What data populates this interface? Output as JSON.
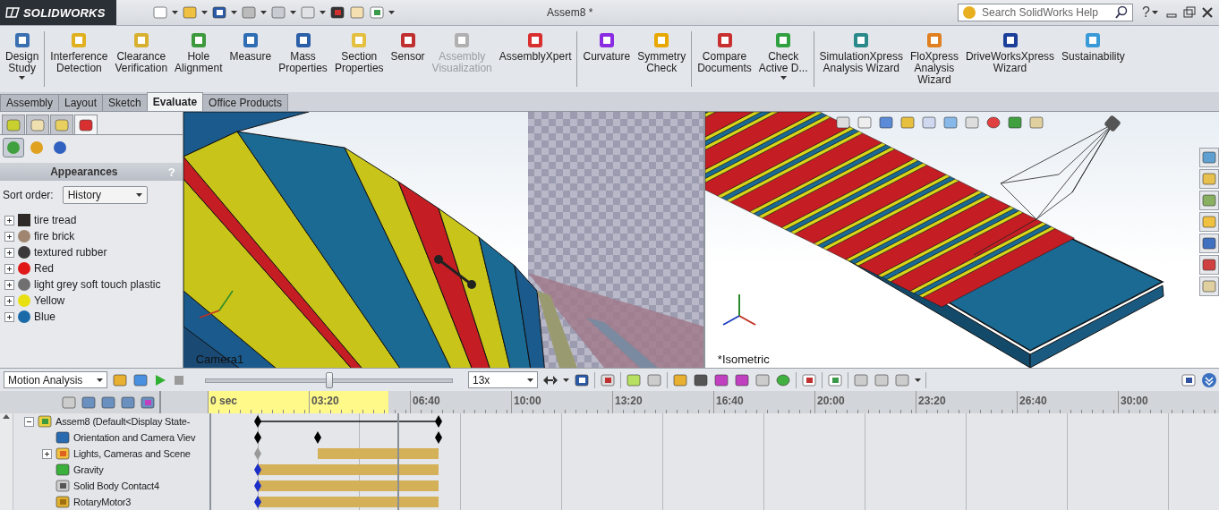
{
  "title_bar": {
    "logo": "SOLIDWORKS",
    "document_title": "Assem8 *",
    "search": {
      "placeholder": "Search SolidWorks Help"
    },
    "help": "?"
  },
  "ribbon": {
    "groups": [
      [
        {
          "label": "Design\nStudy",
          "disabled": false,
          "dropdown": true,
          "color": "#3a6fb0"
        }
      ],
      [
        {
          "label": "Interference\nDetection",
          "disabled": false,
          "dropdown": false,
          "color": "#e0b020"
        },
        {
          "label": "Clearance\nVerification",
          "disabled": false,
          "dropdown": false,
          "color": "#d8b030"
        },
        {
          "label": "Hole\nAlignment",
          "disabled": false,
          "dropdown": false,
          "color": "#3c9a3c"
        },
        {
          "label": "Measure",
          "disabled": false,
          "dropdown": false,
          "color": "#2f6db5"
        },
        {
          "label": "Mass\nProperties",
          "disabled": false,
          "dropdown": false,
          "color": "#2b5fa8"
        },
        {
          "label": "Section\nProperties",
          "disabled": false,
          "dropdown": false,
          "color": "#e4c040"
        },
        {
          "label": "Sensor",
          "disabled": false,
          "dropdown": false,
          "color": "#c03030"
        },
        {
          "label": "Assembly\nVisualization",
          "disabled": true,
          "dropdown": false,
          "color": "#b0b0b0"
        },
        {
          "label": "AssemblyXpert",
          "disabled": false,
          "dropdown": false,
          "color": "#d83030"
        }
      ],
      [
        {
          "label": "Curvature",
          "disabled": false,
          "dropdown": false,
          "color": "#8a2be2"
        },
        {
          "label": "Symmetry\nCheck",
          "disabled": false,
          "dropdown": false,
          "color": "#e8a800"
        }
      ],
      [
        {
          "label": "Compare\nDocuments",
          "disabled": false,
          "dropdown": false,
          "color": "#c83030"
        },
        {
          "label": "Check\nActive D...",
          "disabled": false,
          "dropdown": true,
          "color": "#30a040"
        }
      ],
      [
        {
          "label": "SimulationXpress\nAnalysis Wizard",
          "disabled": false,
          "dropdown": false,
          "color": "#2a8a8a"
        },
        {
          "label": "FloXpress\nAnalysis\nWizard",
          "disabled": false,
          "dropdown": false,
          "color": "#e08020"
        },
        {
          "label": "DriveWorksXpress\nWizard",
          "disabled": false,
          "dropdown": false,
          "color": "#1c3f9a"
        },
        {
          "label": "Sustainability",
          "disabled": false,
          "dropdown": false,
          "color": "#3a9ad8"
        }
      ]
    ]
  },
  "command_tabs": [
    {
      "label": "Assembly",
      "selected": false
    },
    {
      "label": "Layout",
      "selected": false
    },
    {
      "label": "Sketch",
      "selected": false
    },
    {
      "label": "Evaluate",
      "selected": true
    },
    {
      "label": "Office Products",
      "selected": false
    }
  ],
  "left_panel": {
    "panel_tabs": [
      {
        "selected": false
      },
      {
        "selected": false
      },
      {
        "selected": false
      },
      {
        "selected": true
      }
    ],
    "view_buttons": [
      {
        "selected": true
      },
      {
        "selected": false
      },
      {
        "selected": false
      }
    ],
    "header": "Appearances",
    "help": "?",
    "sort_label": "Sort order:",
    "sort_value": "History",
    "items": [
      {
        "label": "tire tread",
        "kind": "texture",
        "color": "#2e2a28"
      },
      {
        "label": "fire brick",
        "kind": "sphere",
        "color": "#a08670"
      },
      {
        "label": "textured rubber",
        "kind": "sphere",
        "color": "#3a3a3a"
      },
      {
        "label": "Red",
        "kind": "sphere",
        "color": "#e01818"
      },
      {
        "label": "light grey soft touch plastic",
        "kind": "sphere",
        "color": "#707070"
      },
      {
        "label": "Yellow",
        "kind": "sphere",
        "color": "#e8e010"
      },
      {
        "label": "Blue",
        "kind": "sphere",
        "color": "#1a6aa8"
      }
    ]
  },
  "viewports": [
    {
      "label": "Camera1"
    },
    {
      "label": "*Isometric"
    }
  ],
  "motion": {
    "study_type": "Motion Analysis",
    "playback": {
      "level": 0.5
    },
    "speed": "13x"
  },
  "timeline": {
    "ticks": [
      "0 sec",
      "03:20",
      "06:40",
      "10:00",
      "13:20",
      "16:40",
      "20:00",
      "23:20",
      "26:40",
      "30:00"
    ],
    "tree": [
      {
        "label": "Assem8  (Default<Display State-",
        "kind": "span",
        "expanded": true,
        "children": [
          {
            "label": "Orientation and Camera Viev",
            "kind": "keys"
          },
          {
            "label": "Lights, Cameras and Scene",
            "kind": "late-bar",
            "expanded": false
          },
          {
            "label": "Gravity",
            "kind": "bar"
          },
          {
            "label": "Solid Body Contact4",
            "kind": "bar"
          },
          {
            "label": "RotaryMotor3",
            "kind": "bar"
          }
        ]
      }
    ]
  }
}
